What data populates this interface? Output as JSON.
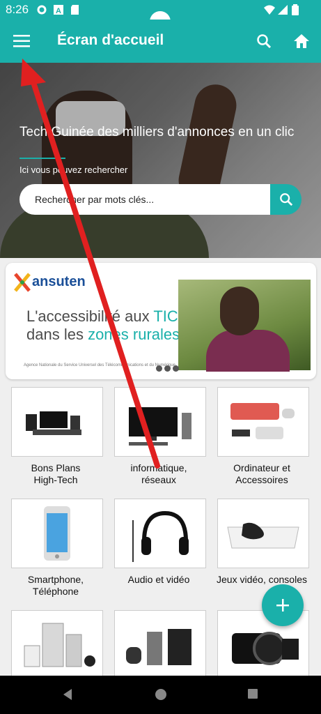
{
  "status_bar": {
    "time": "8:26"
  },
  "app_bar": {
    "title": "Écran d'accueil"
  },
  "hero": {
    "headline": "Tech Guinée des milliers d'annonces en un clic",
    "subtitle": "Ici vous pouvez rechercher",
    "search_placeholder": "Rechercher par mots clés..."
  },
  "banner": {
    "brand": "ansuten",
    "line1_prefix": "L'accessibilité aux ",
    "line1_accent": "TICs",
    "line2_prefix": "dans les ",
    "line2_accent": "zones rurales",
    "footer": "Agence Nationale du Service Universel des Télécommunications et du Numérique"
  },
  "categories": [
    {
      "label": "Bons Plans\nHigh-Tech",
      "icon": "hi-tech-devices-icon"
    },
    {
      "label": "informatique,\nréseaux",
      "icon": "computer-icon"
    },
    {
      "label": "Ordinateur et\nAccessoires",
      "icon": "keyboard-icon"
    },
    {
      "label": "Smartphone,\nTéléphone",
      "icon": "smartphone-icon"
    },
    {
      "label": "Audio et vidéo",
      "icon": "headphones-icon"
    },
    {
      "label": "Jeux vidéo, consoles",
      "icon": "game-console-icon"
    },
    {
      "label": "",
      "icon": "appliances-icon"
    },
    {
      "label": "",
      "icon": "kitchen-appliances-icon"
    },
    {
      "label": "",
      "icon": "camera-icon"
    }
  ],
  "colors": {
    "accent": "#1ab0aa",
    "arrow": "#e02020"
  }
}
